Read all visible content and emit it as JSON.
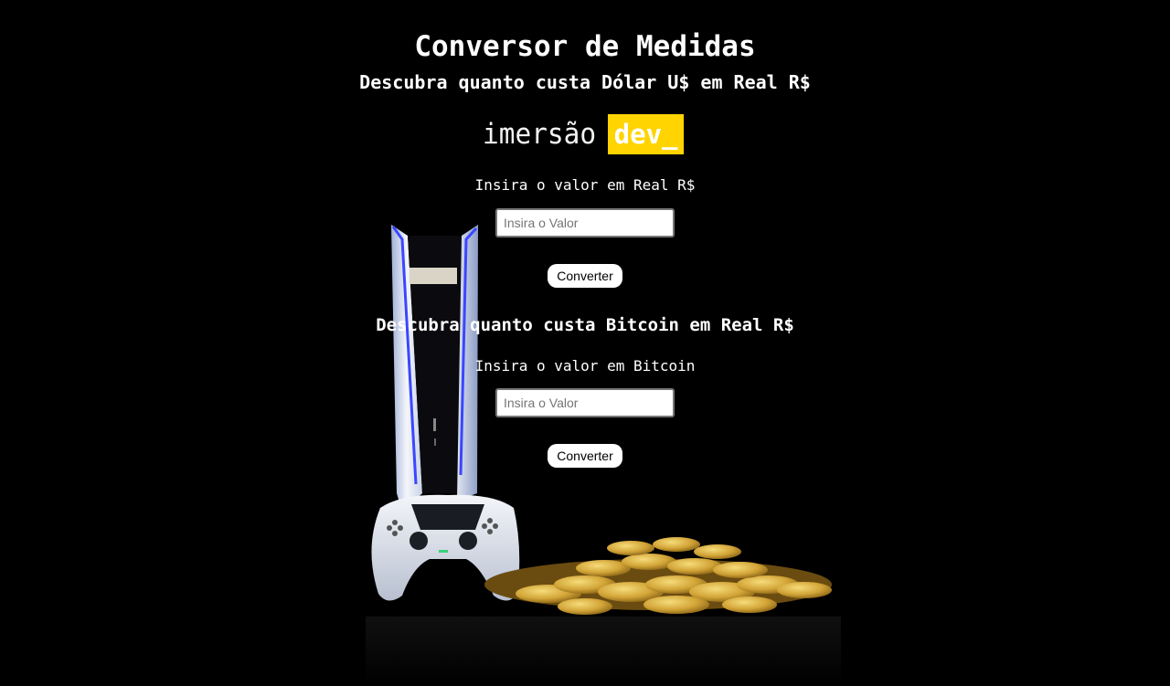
{
  "header": {
    "title": "Conversor de Medidas",
    "subtitle_dollar": "Descubra quanto custa Dólar U$ em Real R$"
  },
  "logo": {
    "word": "imersão",
    "highlight": "dev_",
    "highlight_color": "#ffd400"
  },
  "dollar_section": {
    "label": "Insira o valor em Real R$",
    "input_value": "",
    "input_placeholder": "Insira o Valor",
    "button_label": "Converter"
  },
  "bitcoin_section": {
    "heading": "Descubra quanto custa Bitcoin em Real R$",
    "label": "Insira o valor em Bitcoin",
    "input_value": "",
    "input_placeholder": "Insira o Valor",
    "button_label": "Converter"
  },
  "background": {
    "description_icons": [
      "game-console-icon",
      "game-controller-icon",
      "gold-coins-icon"
    ],
    "colors": {
      "page_bg": "#000000",
      "coin_gold": "#d4a83a",
      "console_white": "#e8ecf2",
      "console_blue": "#2a3cff"
    }
  }
}
